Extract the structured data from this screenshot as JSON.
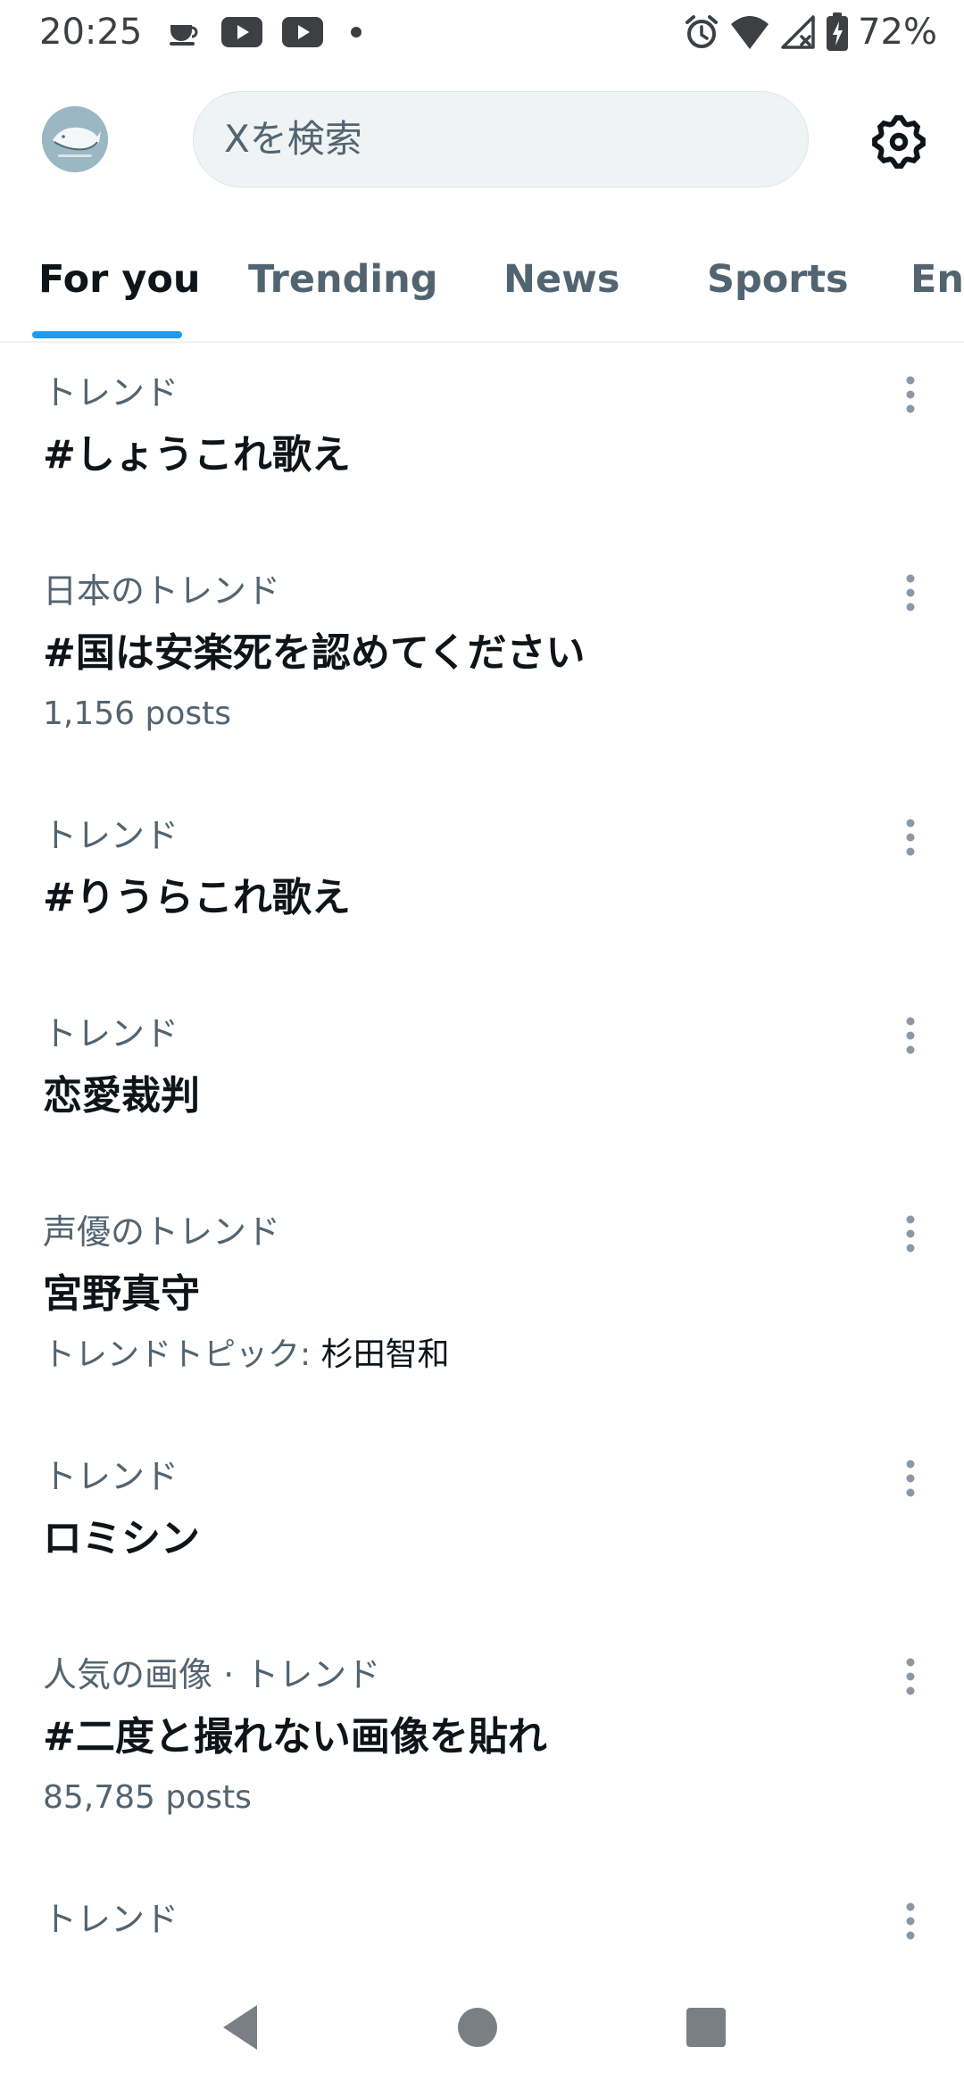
{
  "status_bar": {
    "time": "20:25",
    "battery_percent": "72%",
    "icons": [
      "coffee-icon",
      "youtube-icon",
      "youtube-icon",
      "notification-dot-icon",
      "alarm-icon",
      "wifi-icon",
      "cell-signal-icon",
      "battery-icon"
    ]
  },
  "header": {
    "search_placeholder": "Xを検索",
    "avatar_icon": "whale-avatar",
    "settings_icon": "gear-icon"
  },
  "tabs": [
    {
      "label": "For you",
      "active": true
    },
    {
      "label": "Trending",
      "active": false
    },
    {
      "label": "News",
      "active": false
    },
    {
      "label": "Sports",
      "active": false
    },
    {
      "label": "Ent",
      "active": false
    }
  ],
  "accent_color": "#1d9bf0",
  "trends": [
    {
      "category": "トレンド",
      "title": "#しょうこれ歌え"
    },
    {
      "category": "日本のトレンド",
      "title": "#国は安楽死を認めてください",
      "meta": "1,156 posts"
    },
    {
      "category": "トレンド",
      "title": "#りうらこれ歌え"
    },
    {
      "category": "トレンド",
      "title": "恋愛裁判"
    },
    {
      "category": "声優のトレンド",
      "title": "宮野真守",
      "meta_prefix": "トレンドトピック: ",
      "meta_topic": "杉田智和"
    },
    {
      "category": "トレンド",
      "title": "ロミシン"
    },
    {
      "category": "人気の画像 · トレンド",
      "title": "#二度と撮れない画像を貼れ",
      "meta": "85,785 posts"
    },
    {
      "category": "トレンド"
    }
  ],
  "nav_bar": {
    "icons": [
      "back-icon",
      "home-icon",
      "recents-icon"
    ]
  }
}
